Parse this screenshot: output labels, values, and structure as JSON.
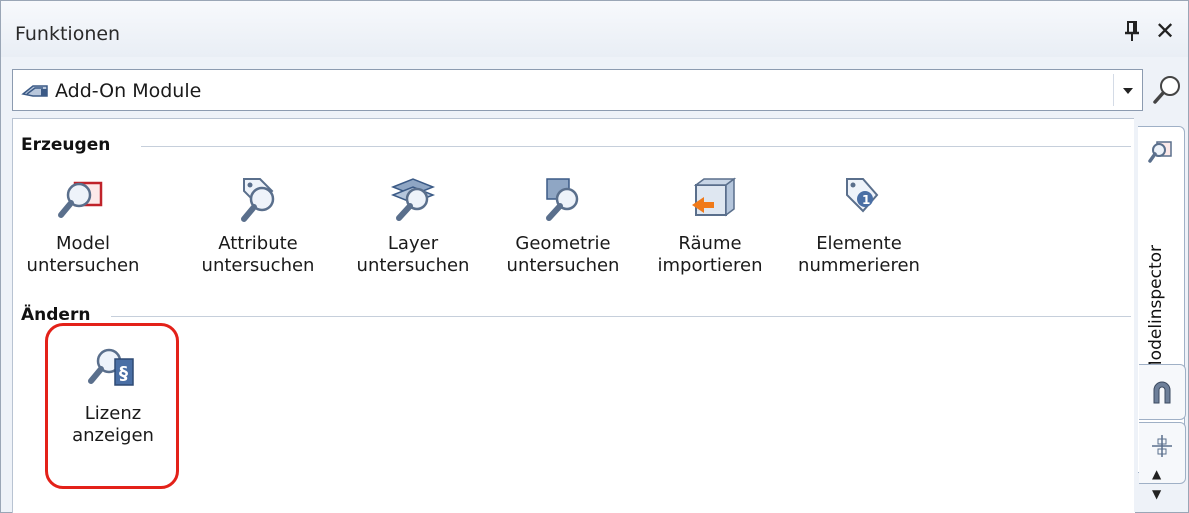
{
  "window": {
    "title": "Funktionen",
    "pin_icon": "pin-icon",
    "close_symbol": "✕"
  },
  "selector": {
    "value": "Add-On Module",
    "icon": "add-on-module-icon"
  },
  "groups": [
    {
      "title": "Erzeugen",
      "tools": [
        {
          "line1": "Model",
          "line2": "untersuchen",
          "icon": "model-inspect-icon"
        },
        {
          "line1": "Attribute",
          "line2": "untersuchen",
          "icon": "attribute-inspect-icon"
        },
        {
          "line1": "Layer",
          "line2": "untersuchen",
          "icon": "layer-inspect-icon"
        },
        {
          "line1": "Geometrie",
          "line2": "untersuchen",
          "icon": "geometry-inspect-icon"
        },
        {
          "line1": "Räume",
          "line2": "importieren",
          "icon": "rooms-import-icon"
        },
        {
          "line1": "Elemente",
          "line2": "nummerieren",
          "icon": "elements-number-icon"
        }
      ]
    },
    {
      "title": "Ändern",
      "tools": [
        {
          "line1": "Lizenz",
          "line2": "anzeigen",
          "icon": "license-show-icon"
        }
      ]
    }
  ],
  "side_tabs": {
    "active": "Modelinspector",
    "others": [
      "magnet-tab-icon",
      "measure-tab-icon"
    ]
  },
  "colors": {
    "highlight": "#e32119",
    "accent_orange": "#f07a1a",
    "icon_blue": "#4a6fa5"
  }
}
